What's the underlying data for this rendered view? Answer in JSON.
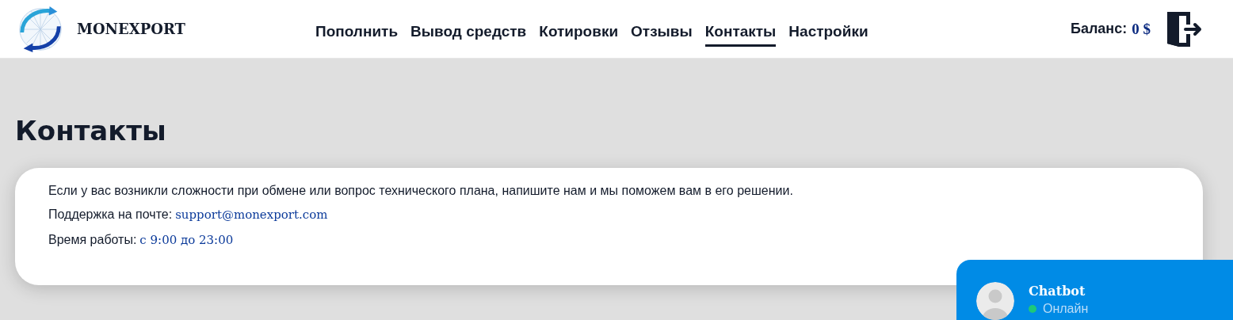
{
  "header": {
    "logo_text": "MONEXPORT",
    "nav": [
      {
        "label": "Пополнить",
        "selected": false
      },
      {
        "label": "Вывод средств",
        "selected": false
      },
      {
        "label": "Котировки",
        "selected": false
      },
      {
        "label": "Отзывы",
        "selected": false
      },
      {
        "label": "Контакты",
        "selected": true
      },
      {
        "label": "Настройки",
        "selected": false
      }
    ],
    "balance_label": "Баланс:",
    "balance_value": "0 $"
  },
  "page": {
    "title": "Контакты",
    "intro": "Если у вас возникли сложности при обмене или вопрос технического плана, напишите нам и мы поможем вам в его решении.",
    "lines": [
      {
        "label": "Поддержка на почте:",
        "value": "support@monexport.com"
      },
      {
        "label": "Время работы:",
        "value": "с 9:00 до 23:00"
      }
    ]
  },
  "chat_widget": {
    "name": "Chatbot",
    "status": "Онлайн",
    "online": true
  }
}
